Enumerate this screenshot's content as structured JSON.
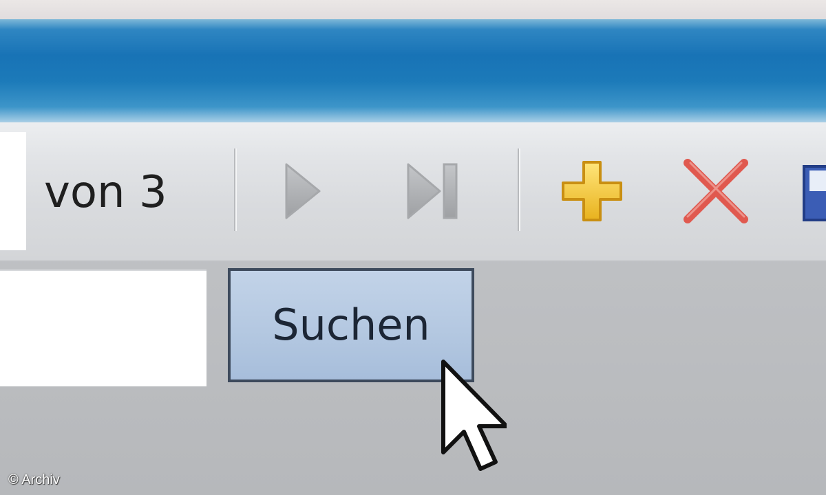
{
  "toolbar": {
    "page_count_label": "von 3",
    "buttons": [
      {
        "name": "next",
        "icon": "play-right-icon",
        "state": "disabled"
      },
      {
        "name": "last",
        "icon": "skip-to-end-icon",
        "state": "disabled"
      },
      {
        "name": "add",
        "icon": "plus-icon"
      },
      {
        "name": "delete",
        "icon": "close-icon"
      },
      {
        "name": "save",
        "icon": "floppy-disk-icon",
        "partially_visible": true
      }
    ]
  },
  "search": {
    "input_value": "",
    "button_label": "Suchen"
  },
  "watermark": {
    "text": "© Archiv"
  },
  "colors": {
    "title_bar": "#1873b6",
    "search_button_bg": "#b4c8e1",
    "search_button_border": "#3d4a5c",
    "add_icon": "#f2c531",
    "delete_icon": "#e0594f",
    "disabled_icon": "#a8aaad"
  }
}
